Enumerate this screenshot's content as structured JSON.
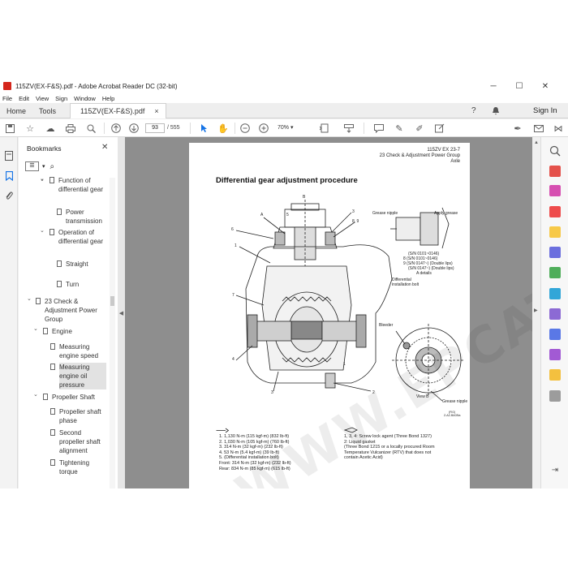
{
  "window": {
    "title": "115ZV(EX-F&S).pdf - Adobe Acrobat Reader DC (32-bit)",
    "minimize": "─",
    "maximize": "☐",
    "close": "✕"
  },
  "menu": [
    "File",
    "Edit",
    "View",
    "Sign",
    "Window",
    "Help"
  ],
  "tabs": {
    "home": "Home",
    "tools": "Tools",
    "doc": "115ZV(EX-F&S).pdf",
    "doc_close": "×",
    "signin": "Sign In"
  },
  "toolbar": {
    "page_current": "93",
    "page_total": "/ 555",
    "zoom": "70%"
  },
  "bookmarks": {
    "title": "Bookmarks",
    "items": [
      "Function of differential gear",
      "Power transmission",
      "Operation of differential gear",
      "Straight",
      "Turn",
      "23 Check & Adjustment Power Group",
      "Engine",
      "Measuring engine speed",
      "Measuring engine oil pressure",
      "Propeller Shaft",
      "Propeller shaft phase",
      "Second propeller shaft alignment",
      "Tightening torque"
    ]
  },
  "page": {
    "header_line1": "115ZV EX 23-7",
    "header_line2": "23 Check & Adjustment Power Group",
    "header_line3": "Axle",
    "title": "Differential gear adjustment procedure",
    "labels": {
      "B": "B",
      "A": "A",
      "n3": "3",
      "n89": "8, 9",
      "n5": "5",
      "n6": "6",
      "n1": "1",
      "n7": "7",
      "n4": "4",
      "n3b": "3",
      "n2": "2",
      "n1b": "1",
      "grease_nipple": "Grease nipple",
      "apply_grease": "Apply grease",
      "sn1": "(S/N 0101~0146)",
      "sn2": "8 (S/N 0101~0146)",
      "sn3": "9 (S/N 0147~) (Double lips)",
      "sn4": "(S/N 0147~) (Double lips)",
      "a_details": "A details",
      "diff_bolt": "Differential installation bolt",
      "bleeder": "Bleeder",
      "view_b": "View B",
      "grease_nipple2": "Grease nipple",
      "fig_code1": "(FIG)",
      "fig_code2": "Z-AZ-BA03ta"
    },
    "torque_left": [
      "1.  1,130 N-m (115 kgf-m) (832 lb-ft)",
      "2.  1,030 N-m (105 kgf-m) (760 lb-ft)",
      "3.  314 N-m (32 kgf-m) (232 lb-ft)",
      "4.  53 N-m (5.4 kgf-m) (39 lb-ft)",
      "5.  (Differential installation bolt)",
      "     Front: 314 N-m (32 kgf-m) (232 lb-ft)",
      "     Rear: 834 N-m (85 kgf-m) (615 lb-ft)"
    ],
    "torque_right": [
      "1, 3, 4: Screw lock agent (Three Bond 1327)",
      "2: Liquid gasket",
      "    (Three Bond 1215 or a locally procured Room",
      "    Temperature Vulcanizer (RTV) that does not",
      "    contain Acetic Acid)"
    ],
    "watermark": "WWW.EPCATO.COM"
  },
  "colors": {
    "accent": "#1473e6",
    "pdf_red": "#d4261c",
    "doc_bg": "#8e8e8e"
  }
}
